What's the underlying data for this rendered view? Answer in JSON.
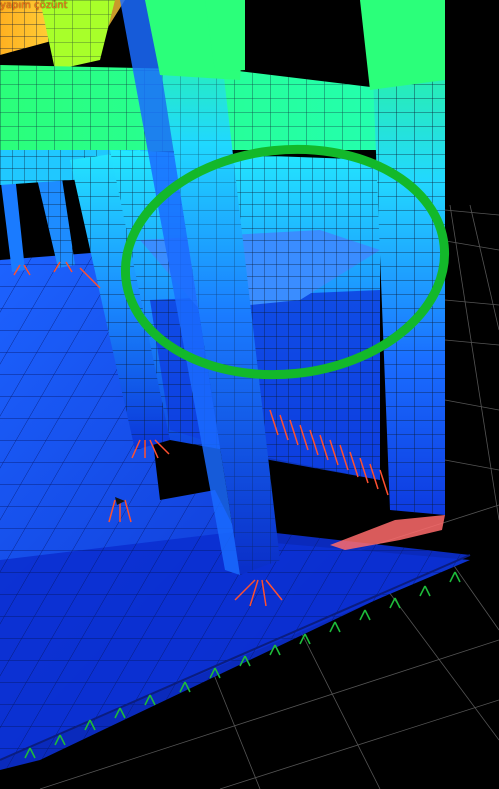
{
  "viewport": {
    "label": "yapım çözünt"
  },
  "colors": {
    "background": "#000000",
    "mesh_line": "#0b1a33",
    "floor_dark": "#0a2ec8",
    "floor_light": "#1e6fff",
    "mid_blue": "#1a7bff",
    "cyan": "#20c8ff",
    "teal": "#22e3c0",
    "green": "#2bff7a",
    "yellow_green": "#a8ff2a",
    "orange": "#ffb020",
    "highlight_ellipse": "#13b82a",
    "support_red": "#ff5030",
    "support_green": "#1dbb3a",
    "grid_line": "#9a9a9a"
  }
}
